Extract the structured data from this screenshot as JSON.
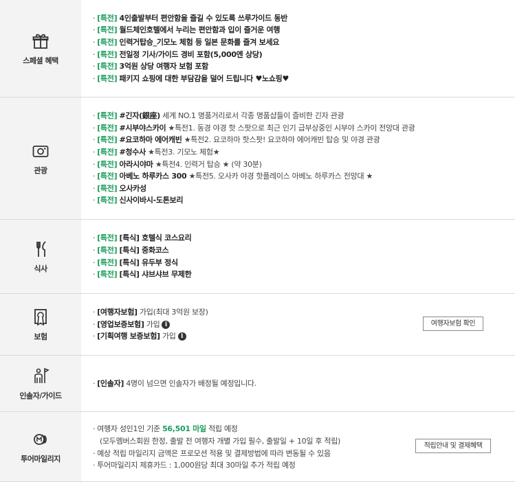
{
  "special": {
    "label": "스페셜 혜택",
    "icon": "gift-icon",
    "items": [
      {
        "tag": "[특전]",
        "bold": "4인출발부터 편안함을 즐길 수 있도록 쓰루가이드 동반",
        "rest": ""
      },
      {
        "tag": "[특전]",
        "bold": "월드체인호텔에서 누리는 편안함과 입이 즐거운 여행",
        "rest": ""
      },
      {
        "tag": "[특전]",
        "bold": "인력거탑승_기모노 체험 등 일본 문화를 즐겨 보세요",
        "rest": ""
      },
      {
        "tag": "[특전]",
        "bold": "전일정 기사/가이드 경비 포함(5,000엔 상당)",
        "rest": ""
      },
      {
        "tag": "[특전]",
        "bold": "3억원 상당 여행자 보험 포함",
        "rest": ""
      },
      {
        "tag": "[특전]",
        "bold": "패키지 쇼핑에 대한 부담감을 덜어 드립니다 ♥노쇼핑♥",
        "rest": ""
      }
    ]
  },
  "sightseeing": {
    "label": "관광",
    "icon": "camera-icon",
    "items": [
      {
        "tag": "[특전]",
        "bold": "#긴자(銀座)",
        "rest": " 세계 NO.1 명품거리로서 각종 명품샵들이 즐비한 긴자 관광"
      },
      {
        "tag": "[특전]",
        "bold": "#시부야스카이",
        "rest": " ★특전1. 동경 야경 핫 스팟으로 최근 인기 급부상중인 시부야 스카이 전망대 관광"
      },
      {
        "tag": "[특전]",
        "bold": "#요코하마 에어캐빈",
        "rest": " ★특전2. 요코하마 핫스팟! 요코하마 에어캐빈 탑승 및 야경 관광"
      },
      {
        "tag": "[특전]",
        "bold": "#청수사",
        "rest": " ★특전3. 기모노 체험★"
      },
      {
        "tag": "[특전]",
        "bold": "아라시야마",
        "rest": " ★특전4. 인력거 탑승 ★ (약 30분)"
      },
      {
        "tag": "[특전]",
        "bold": "아베노 하루카스 300",
        "rest": " ★특전5. 오사카 야경 핫플레이스 아베노 하루카스 전망대 ★"
      },
      {
        "tag": "[특전]",
        "bold": "오사카성",
        "rest": ""
      },
      {
        "tag": "[특전]",
        "bold": "신사이바시-도톤보리",
        "rest": ""
      }
    ]
  },
  "meal": {
    "label": "식사",
    "icon": "fork-knife-icon",
    "items": [
      {
        "tag": "[특전]",
        "bold": "[특식] 호텔식 코스요리",
        "rest": ""
      },
      {
        "tag": "[특전]",
        "bold": "[특식] 중화코스",
        "rest": ""
      },
      {
        "tag": "[특전]",
        "bold": "[특식] 유두부 정식",
        "rest": ""
      },
      {
        "tag": "[특전]",
        "bold": "[특식] 샤브샤브 무제한",
        "rest": ""
      }
    ]
  },
  "insurance": {
    "label": "보험",
    "icon": "insurance-document-icon",
    "items": [
      {
        "bold": "[여행자보험]",
        "rest": " 가입(최대 3억원 보장)",
        "info": false
      },
      {
        "bold": "[영업보증보험]",
        "rest": " 가입",
        "info": true
      },
      {
        "bold": "[기획여행 보증보험]",
        "rest": " 가입",
        "info": true
      }
    ],
    "info_glyph": "i",
    "button": "여행자보험 확인"
  },
  "guide": {
    "label": "인솔자/가이드",
    "icon": "guide-flag-icon",
    "items": [
      {
        "bold": "[인솔자]",
        "rest": " 4명이 넘으면 인솔자가 배정될 예정입니다."
      }
    ]
  },
  "mileage": {
    "label": "투어마일리지",
    "icon": "mileage-coin-icon",
    "line1_pre": "여행자 성인1인 기준 ",
    "line1_value": "56,501 마일",
    "line1_post": " 적립 예정",
    "line2": "(모두멤버스회원 한정, 출발 전 여행자 개별 가입 필수, 출발일 + 10일 후 적립)",
    "line3": "예상 적립 마일리지 금액은 프로모션 적용 및 결제방법에 따라 변동될 수 있음",
    "line4": "투어마일리지 제휴카드 : 1,000원당 최대 30마일 추가 적립 예정",
    "button": "적립안내 및 결제혜택"
  },
  "bullet": "·"
}
